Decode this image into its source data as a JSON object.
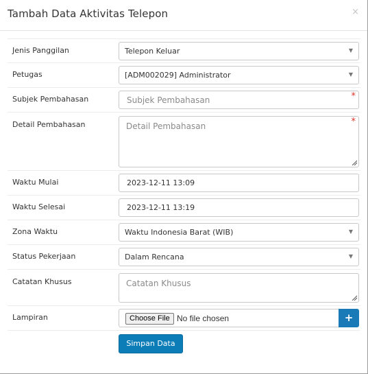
{
  "modal": {
    "title": "Tambah Data Aktivitas Telepon",
    "close_symbol": "×"
  },
  "fields": {
    "jenis_panggilan": {
      "label": "Jenis Panggilan",
      "value": "Telepon Keluar"
    },
    "petugas": {
      "label": "Petugas",
      "value": "[ADM002029] Administrator"
    },
    "subjek": {
      "label": "Subjek Pembahasan",
      "placeholder": "Subjek Pembahasan",
      "required_mark": "*"
    },
    "detail": {
      "label": "Detail Pembahasan",
      "placeholder": "Detail Pembahasan",
      "required_mark": "*"
    },
    "waktu_mulai": {
      "label": "Waktu Mulai",
      "value": "2023-12-11 13:09"
    },
    "waktu_selesai": {
      "label": "Waktu Selesai",
      "value": "2023-12-11 13:19"
    },
    "zona_waktu": {
      "label": "Zona Waktu",
      "value": "Waktu Indonesia Barat (WIB)"
    },
    "status": {
      "label": "Status Pekerjaan",
      "value": "Dalam Rencana"
    },
    "catatan": {
      "label": "Catatan Khusus",
      "placeholder": "Catatan Khusus"
    },
    "lampiran": {
      "label": "Lampiran",
      "choose_label": "Choose File",
      "no_file_text": "No file chosen",
      "add_symbol": "+"
    }
  },
  "actions": {
    "submit_label": "Simpan Data"
  },
  "icons": {
    "dropdown": "caret-down-icon",
    "close": "close-icon",
    "add": "plus-icon"
  },
  "colors": {
    "primary": "#0d7db8",
    "required": "#d9342b"
  }
}
